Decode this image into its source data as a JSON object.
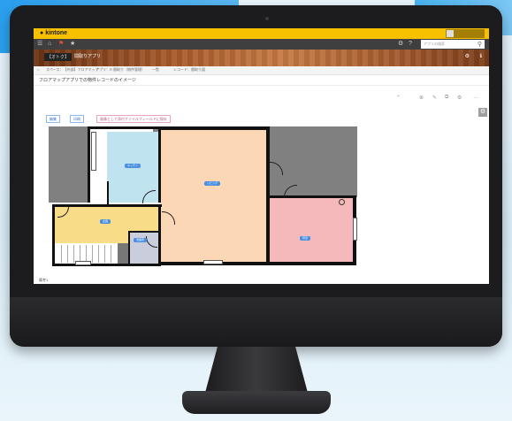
{
  "colors": {
    "kintone_yellow": "#f7c100",
    "nav_dark": "#3f3f3f",
    "kitchen": "#bfe3ef",
    "living": "#fbd7b6",
    "bedroom": "#f6b9bb",
    "entrance": "#f8dc87",
    "washroom": "#c9cddc",
    "outside_gray": "#808080",
    "label_blue": "#4a90e2"
  },
  "header": {
    "logo": "kintone",
    "user": "",
    "user_name_text": "",
    "search_placeholder": "アプリの検索"
  },
  "nav": {
    "icons": [
      "menu-icon",
      "home-icon",
      "notification-icon",
      "star-icon"
    ]
  },
  "banner": {
    "app_tag": "【オトク】",
    "title": "間取りアプリ"
  },
  "breadcrumb": {
    "items": [
      "スペース：【外部】フロアマップ",
      "アプリ：R 間取り（物件管理）",
      "一覧",
      "レコード：間取り図"
    ]
  },
  "record": {
    "title": "フロアマップアプリでの物件レコードのイメージ"
  },
  "toolbar": {
    "more": "…"
  },
  "buttons": {
    "edit": "編集",
    "print": "印刷",
    "attach": "画像として添付ファイルフィールドに保存"
  },
  "rooms": {
    "kitchen": "キッチン",
    "living": "リビング",
    "entrance": "玄関",
    "bedroom": "寝室",
    "washroom": "洗面所"
  },
  "footer": {
    "note": "備考1"
  }
}
